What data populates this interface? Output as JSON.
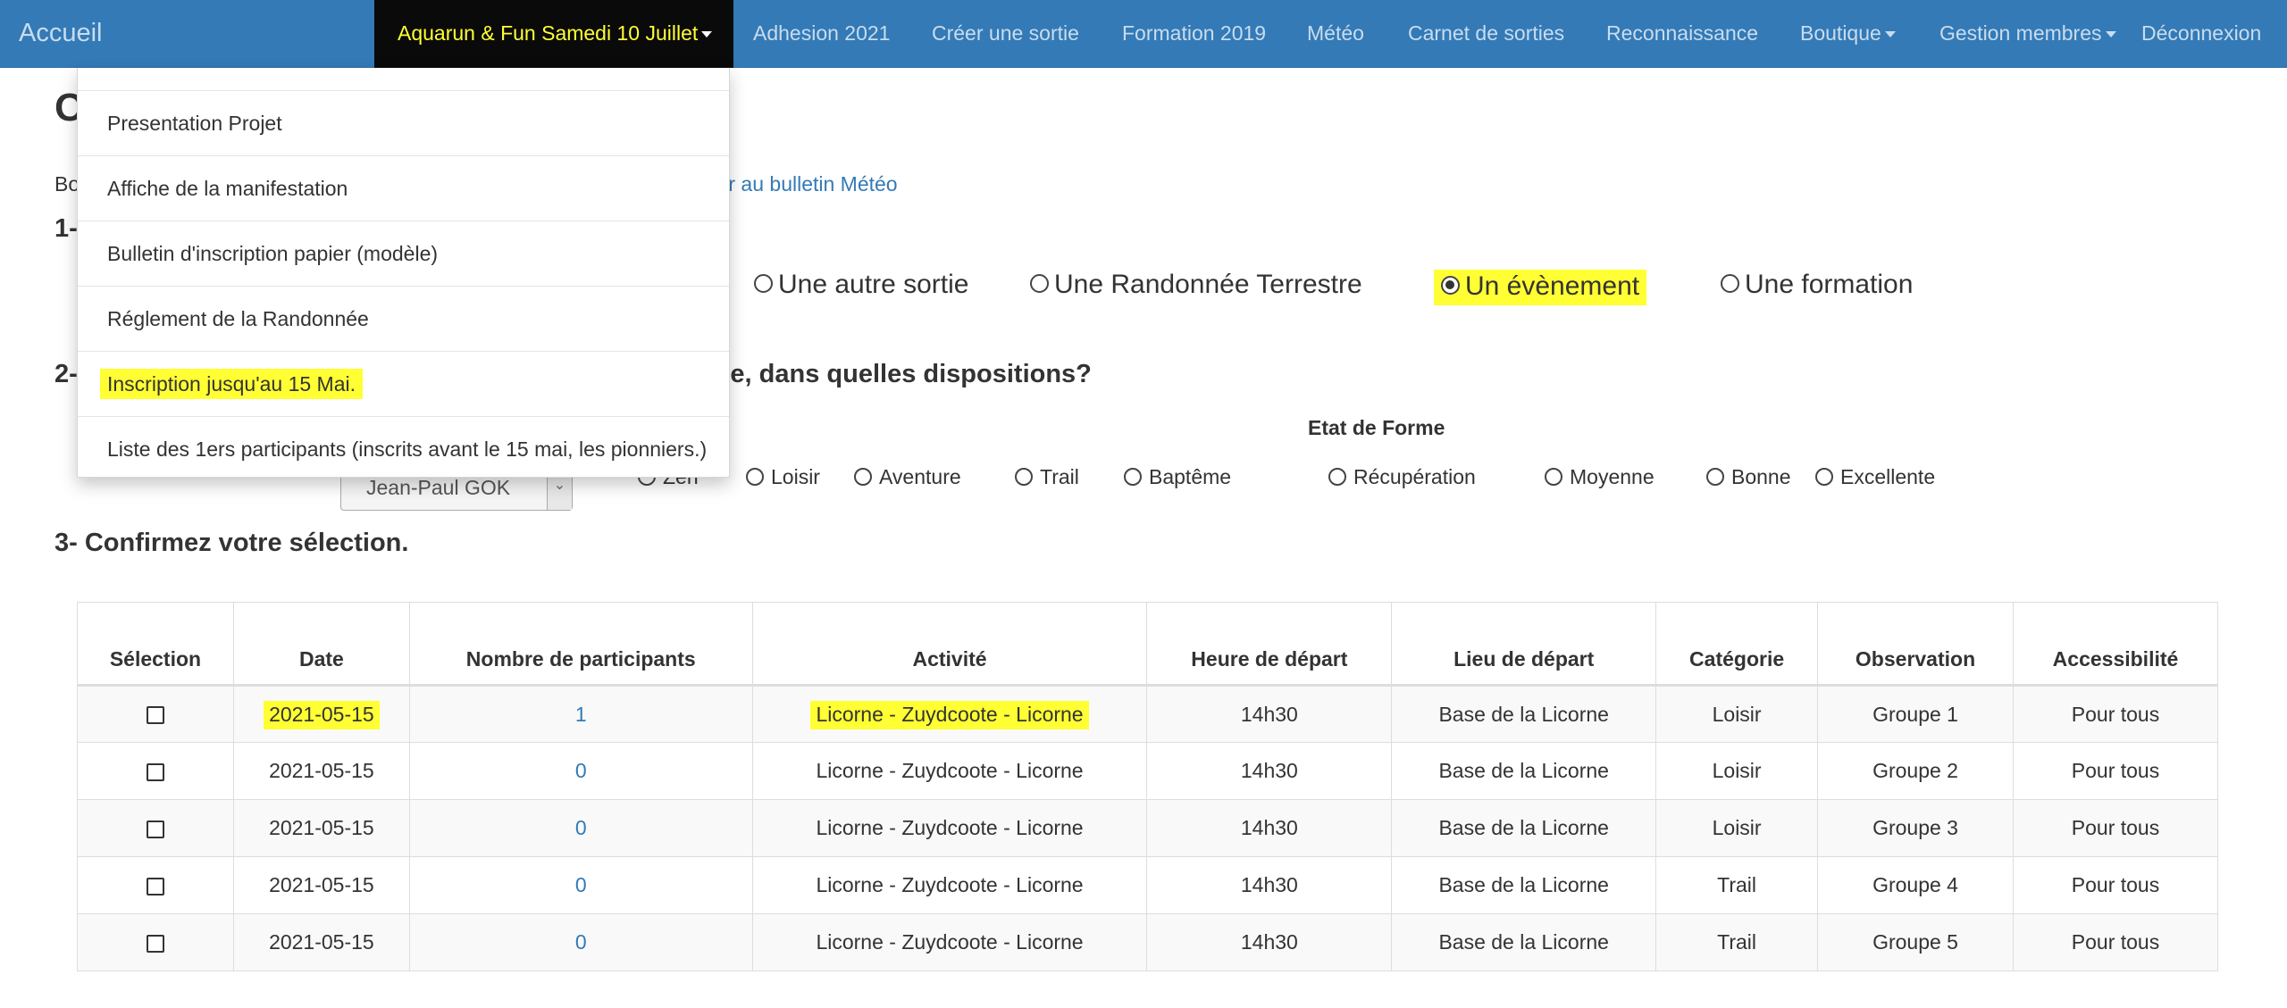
{
  "navbar": {
    "brand": "Accueil",
    "items": [
      {
        "label": "Aquarun & Fun Samedi 10 Juillet",
        "dropdown": true,
        "active": true
      },
      {
        "label": "Adhesion 2021",
        "dropdown": false
      },
      {
        "label": "Créer une sortie",
        "dropdown": false
      },
      {
        "label": "Formation 2019",
        "dropdown": false
      },
      {
        "label": "Météo",
        "dropdown": false
      },
      {
        "label": "Carnet de sorties",
        "dropdown": false
      },
      {
        "label": "Reconnaissance",
        "dropdown": false
      },
      {
        "label": "Boutique",
        "dropdown": true
      },
      {
        "label": "Gestion membres",
        "dropdown": true
      },
      {
        "label": "Déconnexion",
        "dropdown": false
      }
    ]
  },
  "dropdown_menu": {
    "items": [
      {
        "label": "Presentation Projet"
      },
      {
        "label": "Affiche de la manifestation"
      },
      {
        "label": "Bulletin d'inscription papier (modèle)"
      },
      {
        "label": "Réglement de la Randonnée"
      },
      {
        "label": "Inscription jusqu'au 15 Mai.",
        "highlight": true
      },
      {
        "label": "Liste des 1ers participants (inscrits avant le 15 mai, les pionniers.)"
      }
    ]
  },
  "page": {
    "title_fragment": "O",
    "intro_fragment": "Bo",
    "meteo_link": "eder au bulletin Météo"
  },
  "section1": {
    "number_fragment": "1-",
    "options": [
      {
        "label": "Une autre sortie",
        "checked": false
      },
      {
        "label": "Une Randonnée Terrestre",
        "checked": false
      },
      {
        "label": "Un évènement",
        "checked": true,
        "highlight": true
      },
      {
        "label": "Une formation",
        "checked": false
      }
    ]
  },
  "section2": {
    "number_fragment": "2-",
    "title_fragment": "upe, dans quelles dispositions?",
    "member_select": {
      "value": "Jean-Paul GOK"
    },
    "categories": [
      {
        "label": "Zen",
        "checked": false
      },
      {
        "label": "Loisir",
        "checked": false
      },
      {
        "label": "Aventure",
        "checked": false
      },
      {
        "label": "Trail",
        "checked": false
      },
      {
        "label": "Baptême",
        "checked": false
      }
    ],
    "etat_de_forme": {
      "title": "Etat de Forme",
      "options": [
        {
          "label": "Récupération",
          "checked": false
        },
        {
          "label": "Moyenne",
          "checked": false
        },
        {
          "label": "Bonne",
          "checked": false
        },
        {
          "label": "Excellente",
          "checked": false
        }
      ]
    }
  },
  "section3": {
    "title": "3- Confirmez votre sélection."
  },
  "table": {
    "headers": [
      "Sélection",
      "Date",
      "Nombre de participants",
      "Activité",
      "Heure de départ",
      "Lieu de départ",
      "Catégorie",
      "Observation",
      "Accessibilité"
    ],
    "rows": [
      {
        "date": "2021-05-15",
        "participants": "1",
        "activite": "Licorne - Zuydcoote - Licorne",
        "heure": "14h30",
        "lieu": "Base de la Licorne",
        "categorie": "Loisir",
        "observation": "Groupe 1",
        "accessibilite": "Pour tous",
        "highlight": true
      },
      {
        "date": "2021-05-15",
        "participants": "0",
        "activite": "Licorne - Zuydcoote - Licorne",
        "heure": "14h30",
        "lieu": "Base de la Licorne",
        "categorie": "Loisir",
        "observation": "Groupe 2",
        "accessibilite": "Pour tous"
      },
      {
        "date": "2021-05-15",
        "participants": "0",
        "activite": "Licorne - Zuydcoote - Licorne",
        "heure": "14h30",
        "lieu": "Base de la Licorne",
        "categorie": "Loisir",
        "observation": "Groupe 3",
        "accessibilite": "Pour tous"
      },
      {
        "date": "2021-05-15",
        "participants": "0",
        "activite": "Licorne - Zuydcoote - Licorne",
        "heure": "14h30",
        "lieu": "Base de la Licorne",
        "categorie": "Trail",
        "observation": "Groupe 4",
        "accessibilite": "Pour tous"
      },
      {
        "date": "2021-05-15",
        "participants": "0",
        "activite": "Licorne - Zuydcoote - Licorne",
        "heure": "14h30",
        "lieu": "Base de la Licorne",
        "categorie": "Trail",
        "observation": "Groupe 5",
        "accessibilite": "Pour tous"
      }
    ]
  },
  "colors": {
    "navbar_bg": "#337ab7",
    "navbar_active_bg": "#0a0a0a",
    "navbar_active_text": "#ffff33",
    "highlight": "#ffff33",
    "link": "#337ab7"
  }
}
